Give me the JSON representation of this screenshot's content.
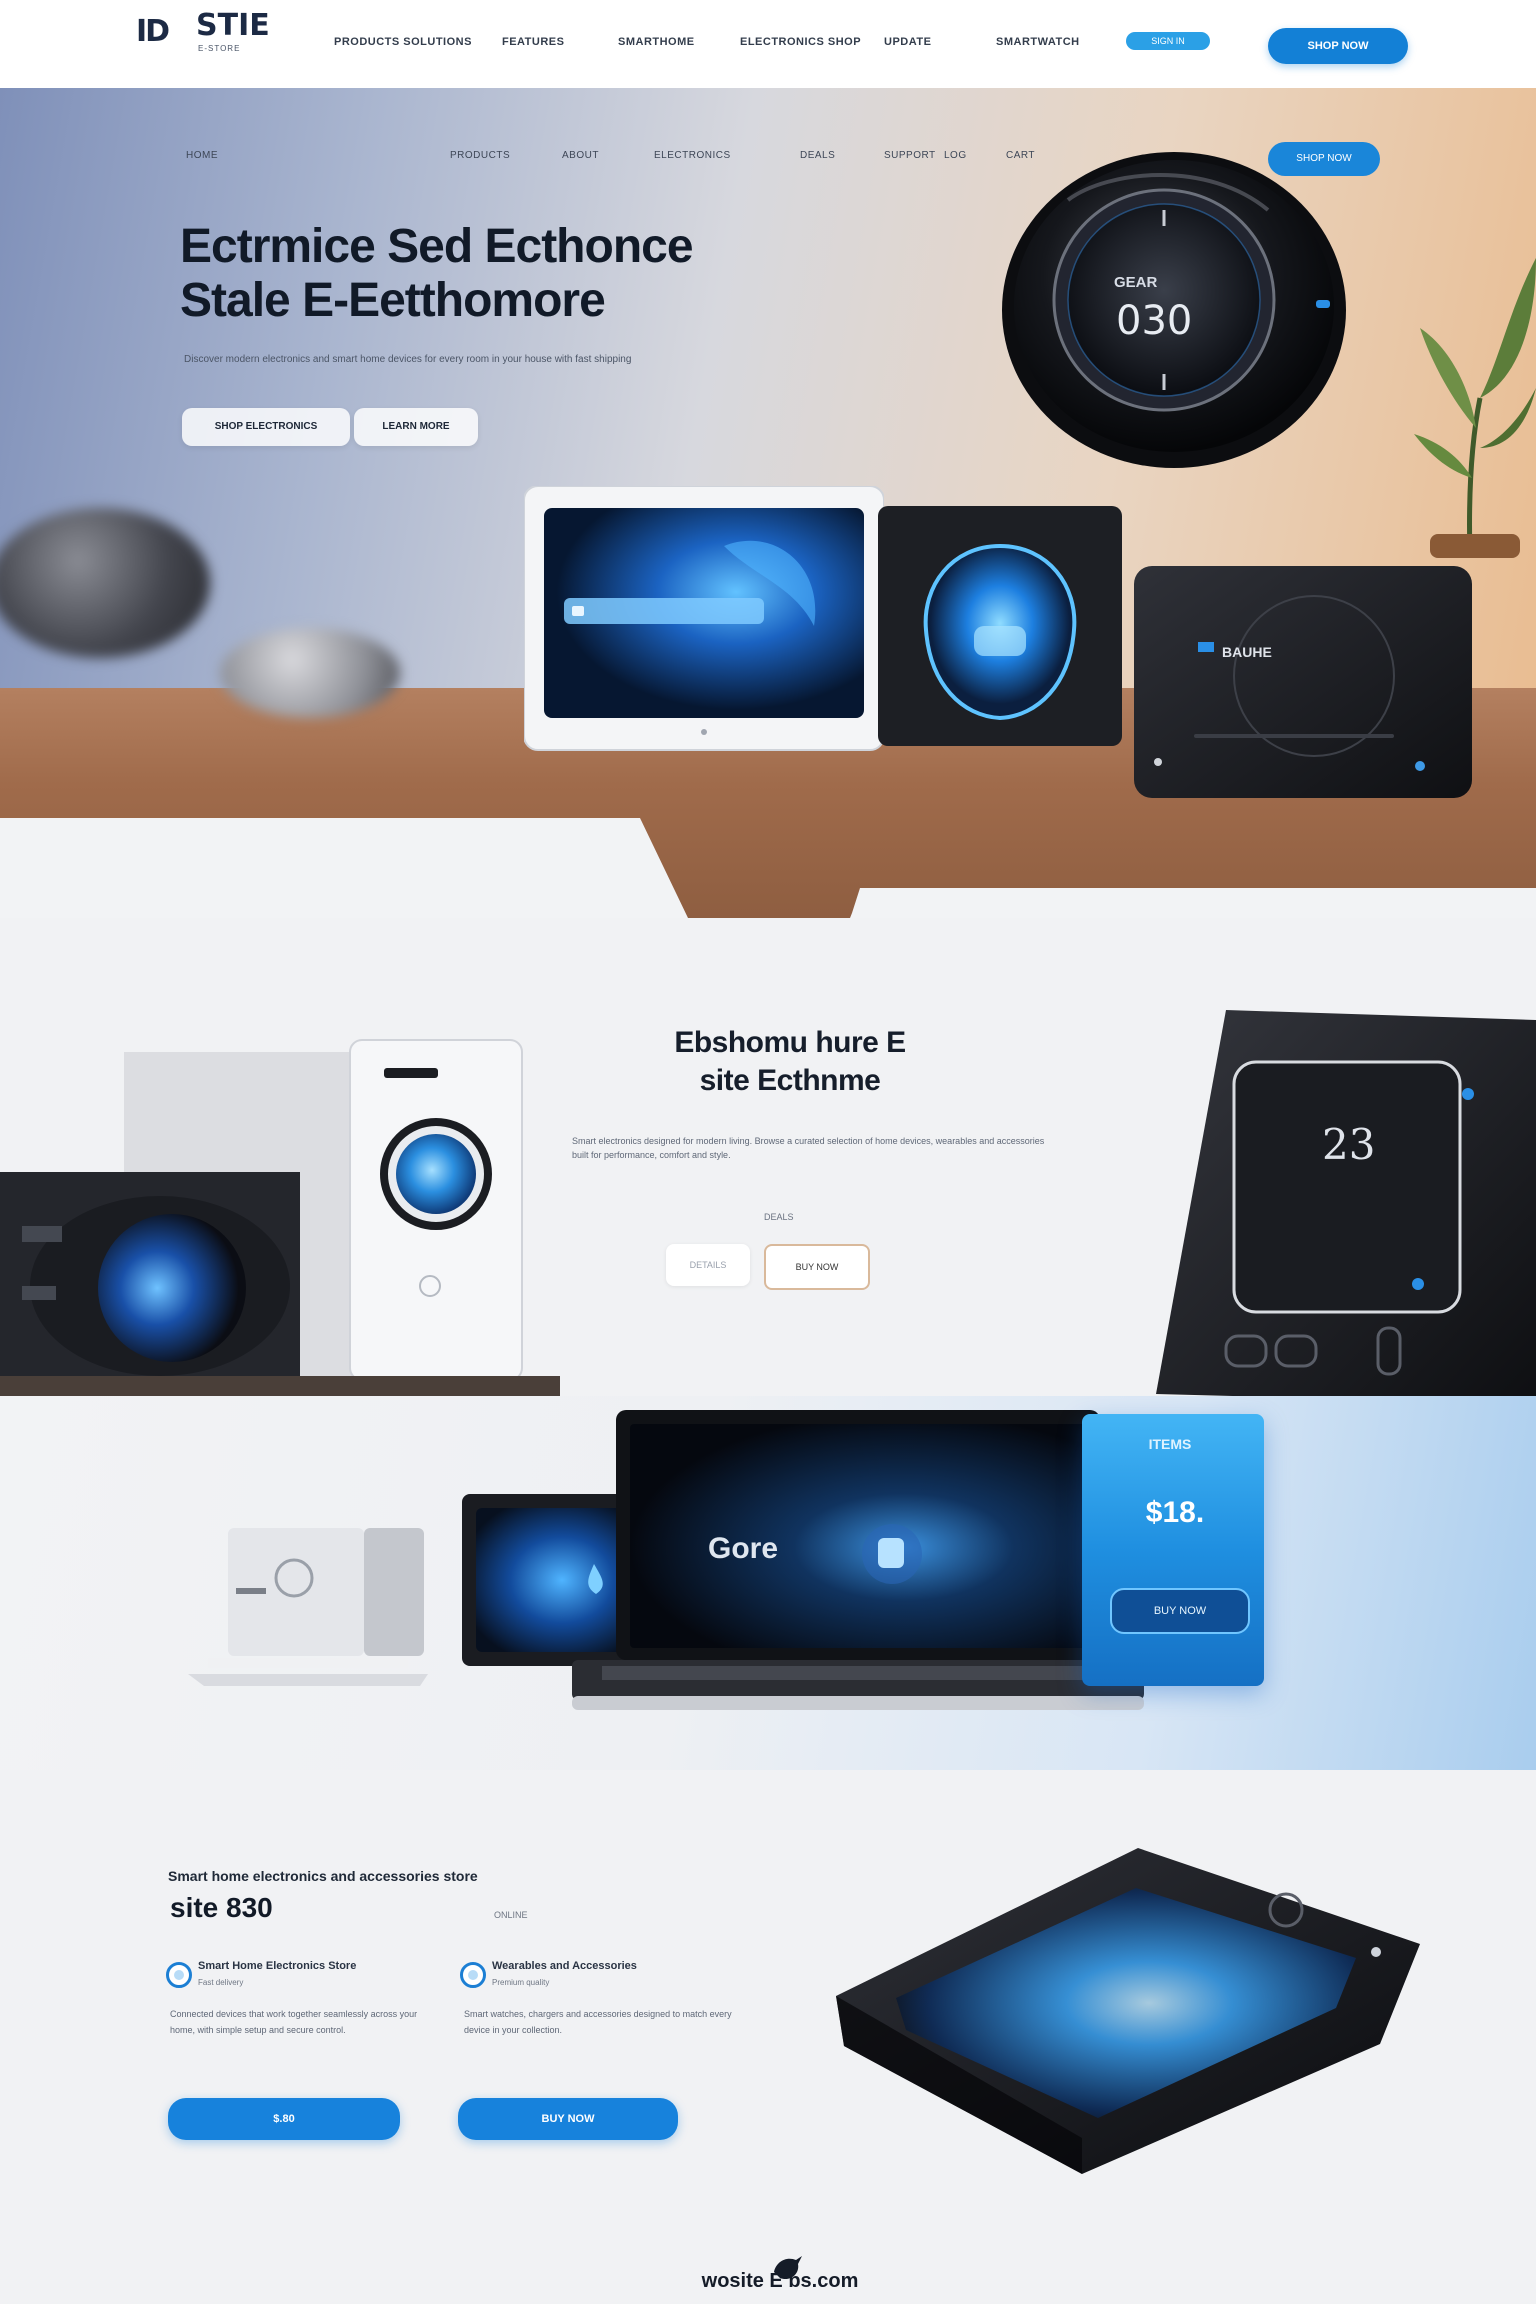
{
  "header": {
    "logo_mark": "ID",
    "logo_word": "STIE",
    "logo_tagline": "E-STORE",
    "nav": [
      "PRODUCTS SOLUTIONS",
      "FEATURES",
      "SMARTHOME",
      "ELECTRONICS SHOP",
      "UPDATE",
      "SMARTWATCH"
    ],
    "nav_pill": "SIGN IN",
    "cta": "SHOP NOW"
  },
  "hero": {
    "nav": [
      "HOME",
      "PRODUCTS",
      "ABOUT",
      "ELECTRONICS",
      "DEALS",
      "SUPPORT",
      "LOG",
      "CART"
    ],
    "pill": "SHOP NOW",
    "title_line1": "Ectrmice Sed Ecthonce",
    "title_line2": "Stale E-Eetthomore",
    "subtitle": "Discover modern electronics and smart home devices for every room in your house with fast shipping",
    "btn_primary": "SHOP ELECTRONICS",
    "btn_secondary": "LEARN MORE",
    "watch_display": "030",
    "watch_brand": "GEAR",
    "panel_label": "BAUHE"
  },
  "section2": {
    "title_line1": "Ebshomu hure E",
    "title_line2": "site Ecthnme",
    "body": "Smart electronics designed for modern living. Browse a curated selection of home devices, wearables and accessories built for performance, comfort and style.",
    "small": "DEALS",
    "btn_a": "DETAILS",
    "btn_b": "BUY NOW",
    "tablet_display": "23"
  },
  "section3": {
    "laptop_display": "Gore",
    "card_title": "ITEMS",
    "card_value": "$18.",
    "card_btn": "BUY NOW"
  },
  "section4": {
    "subtitle": "Smart home electronics and accessories store",
    "title": "site 830",
    "small": "ONLINE",
    "features": [
      {
        "title": "Smart Home Electronics Store",
        "note": "Fast delivery",
        "body": "Connected devices that work together seamlessly across your home, with simple setup and secure control.",
        "button": "$.80"
      },
      {
        "title": "Wearables and Accessories",
        "note": "Premium quality",
        "body": "Smart watches, chargers and accessories designed to match every device in your collection.",
        "button": "BUY NOW"
      }
    ]
  },
  "footer": {
    "text": "wosite E  bs.com"
  }
}
